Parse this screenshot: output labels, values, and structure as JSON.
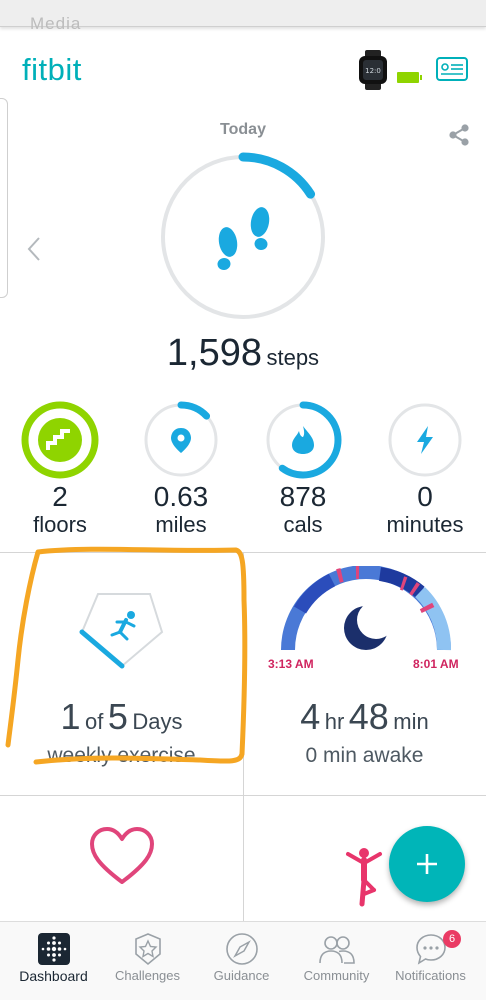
{
  "app": {
    "logo": "fitbit",
    "top_ghost_text": "Media"
  },
  "header": {
    "date_label": "Today",
    "icons": [
      "device-watch-icon",
      "battery-icon",
      "profile-card-icon",
      "share-icon"
    ]
  },
  "steps": {
    "value": "1,598",
    "unit": "steps",
    "progress": 0.16
  },
  "metrics": [
    {
      "value": "2",
      "label": "floors",
      "progress": 1.0,
      "icon": "stairs-icon"
    },
    {
      "value": "0.63",
      "label": "miles",
      "progress": 0.13,
      "icon": "location-pin-icon"
    },
    {
      "value": "878",
      "label": "cals",
      "progress": 0.6,
      "icon": "flame-icon"
    },
    {
      "value": "0",
      "label": "minutes",
      "progress": 0.0,
      "icon": "lightning-icon"
    }
  ],
  "exercise": {
    "count": "1",
    "of_word": "of",
    "goal": "5",
    "unit": "Days",
    "subtitle": "weekly exercise",
    "progress": 0.2
  },
  "sleep": {
    "start": "3:13 AM",
    "end": "8:01 AM",
    "hours": "4",
    "hr_unit": "hr",
    "minutes": "48",
    "min_unit": "min",
    "subtitle": "0 min awake"
  },
  "nav": {
    "items": [
      {
        "label": "Dashboard",
        "icon": "dashboard-icon",
        "active": true
      },
      {
        "label": "Challenges",
        "icon": "star-badge-icon",
        "active": false
      },
      {
        "label": "Guidance",
        "icon": "compass-icon",
        "active": false
      },
      {
        "label": "Community",
        "icon": "people-icon",
        "active": false
      },
      {
        "label": "Notifications",
        "icon": "chat-bubble-icon",
        "active": false
      }
    ],
    "notification_count": "6"
  },
  "colors": {
    "brand": "#00b0b9",
    "steps_arc": "#00a9e0",
    "floors": "#8fd400",
    "sleep_pink": "#d0245f",
    "heart": "#e0457b",
    "annotation": "#f5a623"
  }
}
